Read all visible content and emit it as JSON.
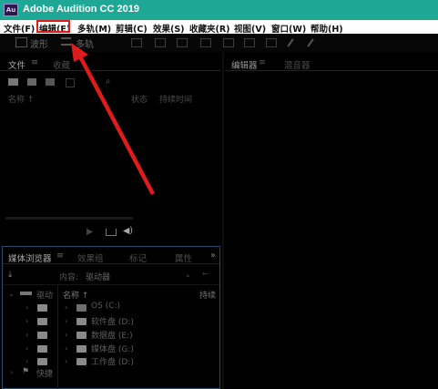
{
  "app": {
    "title": "Adobe Audition CC 2019",
    "logo_text": "Au"
  },
  "menu": {
    "items": [
      {
        "label": "文件(F)"
      },
      {
        "label": "编辑(E)"
      },
      {
        "label": "多轨(M)"
      },
      {
        "label": "剪辑(C)"
      },
      {
        "label": "效果(S)"
      },
      {
        "label": "收藏夹(R)"
      },
      {
        "label": "视图(V)"
      },
      {
        "label": "窗口(W)"
      },
      {
        "label": "帮助(H)"
      }
    ],
    "highlighted": "编辑(E)"
  },
  "toolbar": {
    "waveform_label": "波形",
    "multitrack_label": "多轨"
  },
  "files_panel": {
    "tab_files": "文件",
    "tab_favorites": "收藏",
    "col_name": "名称 ↑",
    "col_status": "状态",
    "col_duration": "持续时间"
  },
  "editor_panel": {
    "tab_editor": "编辑器",
    "tab_mixer": "混音器"
  },
  "media_browser": {
    "tab_media": "媒体浏览器",
    "tab_effects": "效果组",
    "tab_markers": "标记",
    "tab_properties": "属性",
    "content_label": "内容:",
    "content_value": "驱动器",
    "col_name": "名称 ↑",
    "col_duration": "持续",
    "left_drives": "驱动",
    "left_shortcuts": "快捷",
    "drives": [
      {
        "label": "OS (C:)"
      },
      {
        "label": "软件盘 (D:)"
      },
      {
        "label": "数据盘 (E:)"
      },
      {
        "label": "媒体盘 (G:)"
      },
      {
        "label": "工作盘 (D:)"
      }
    ]
  },
  "annotation": {
    "color": "#e01b1b"
  }
}
